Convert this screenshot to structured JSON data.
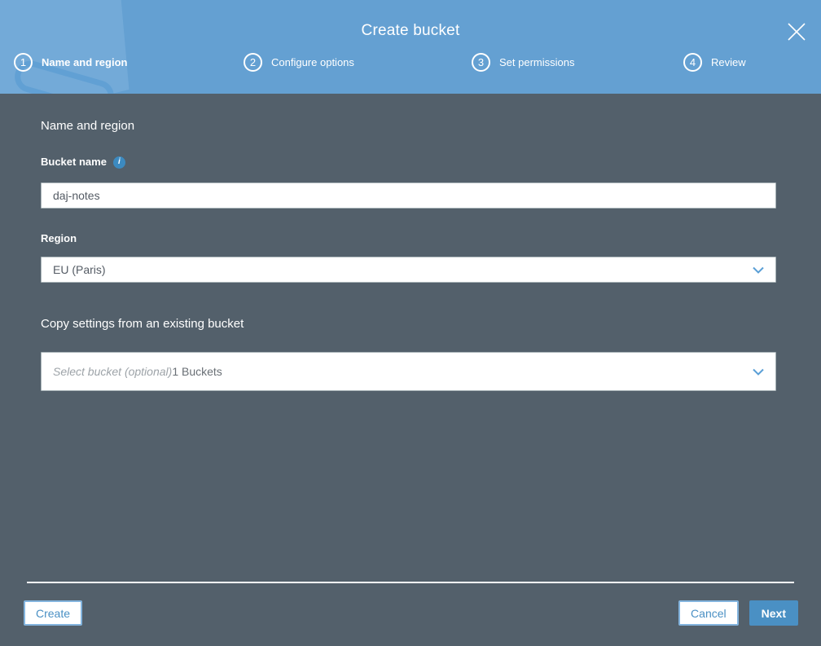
{
  "colors": {
    "header_blue": "#64a0d2",
    "body_slate": "#53606b",
    "accent_blue": "#4a90c4",
    "watermark_blue": "#73aad8"
  },
  "icons": {
    "close": "close-icon (thin x)",
    "chevron_down": "chevron-down-icon",
    "info": "i",
    "watermark": "bucket-watermark"
  },
  "header": {
    "title": "Create bucket"
  },
  "steps": [
    {
      "number": "1",
      "label": "Name and region"
    },
    {
      "number": "2",
      "label": "Configure options"
    },
    {
      "number": "3",
      "label": "Set permissions"
    },
    {
      "number": "4",
      "label": "Review"
    }
  ],
  "form": {
    "section_heading": "Name and region",
    "bucket_name": {
      "label": "Bucket name",
      "value": "daj-notes"
    },
    "region": {
      "label": "Region",
      "selected": "EU (Paris)"
    },
    "copy_settings": {
      "heading": "Copy settings from an existing bucket",
      "placeholder": "Select bucket (optional)",
      "bucket_count": "1 Buckets"
    }
  },
  "footer": {
    "create_label": "Create",
    "cancel_label": "Cancel",
    "next_label": "Next"
  }
}
